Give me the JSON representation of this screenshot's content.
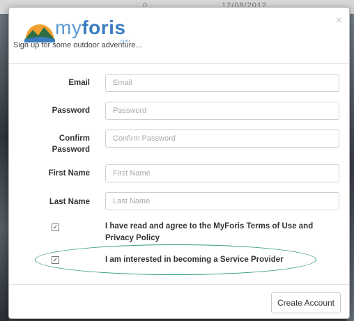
{
  "background": {
    "date_text": "12/08/2012",
    "ghost_text": "0"
  },
  "brand": {
    "name_light": "my",
    "name_bold": "foris",
    "domain_suffix": ".com",
    "tagline": "Sign up for some outdoor adventure..."
  },
  "modal": {
    "close_symbol": "×"
  },
  "form": {
    "email": {
      "label": "Email",
      "placeholder": "Email",
      "value": ""
    },
    "password": {
      "label": "Password",
      "placeholder": "Password",
      "value": ""
    },
    "confirm_password": {
      "label_line1": "Confirm",
      "label_line2": "Password",
      "placeholder": "Confirm Password",
      "value": ""
    },
    "first_name": {
      "label": "First Name",
      "placeholder": "First Name",
      "value": ""
    },
    "last_name": {
      "label": "Last Name",
      "placeholder": "Last Name",
      "value": ""
    },
    "terms": {
      "checked": true,
      "text": "I have read and agree to the MyForis Terms of Use and Privacy Policy"
    },
    "service_provider": {
      "checked": true,
      "text": "I am interested in becoming a Service Provider"
    }
  },
  "footer": {
    "create_button": "Create Account"
  },
  "colors": {
    "brand_blue": "#3a7dbf",
    "annotation_green": "#2e9a7a"
  },
  "icons": {
    "logo": "mountain-sunrise-icon",
    "close": "close-icon",
    "checkbox": "checkbox-checked-icon"
  }
}
